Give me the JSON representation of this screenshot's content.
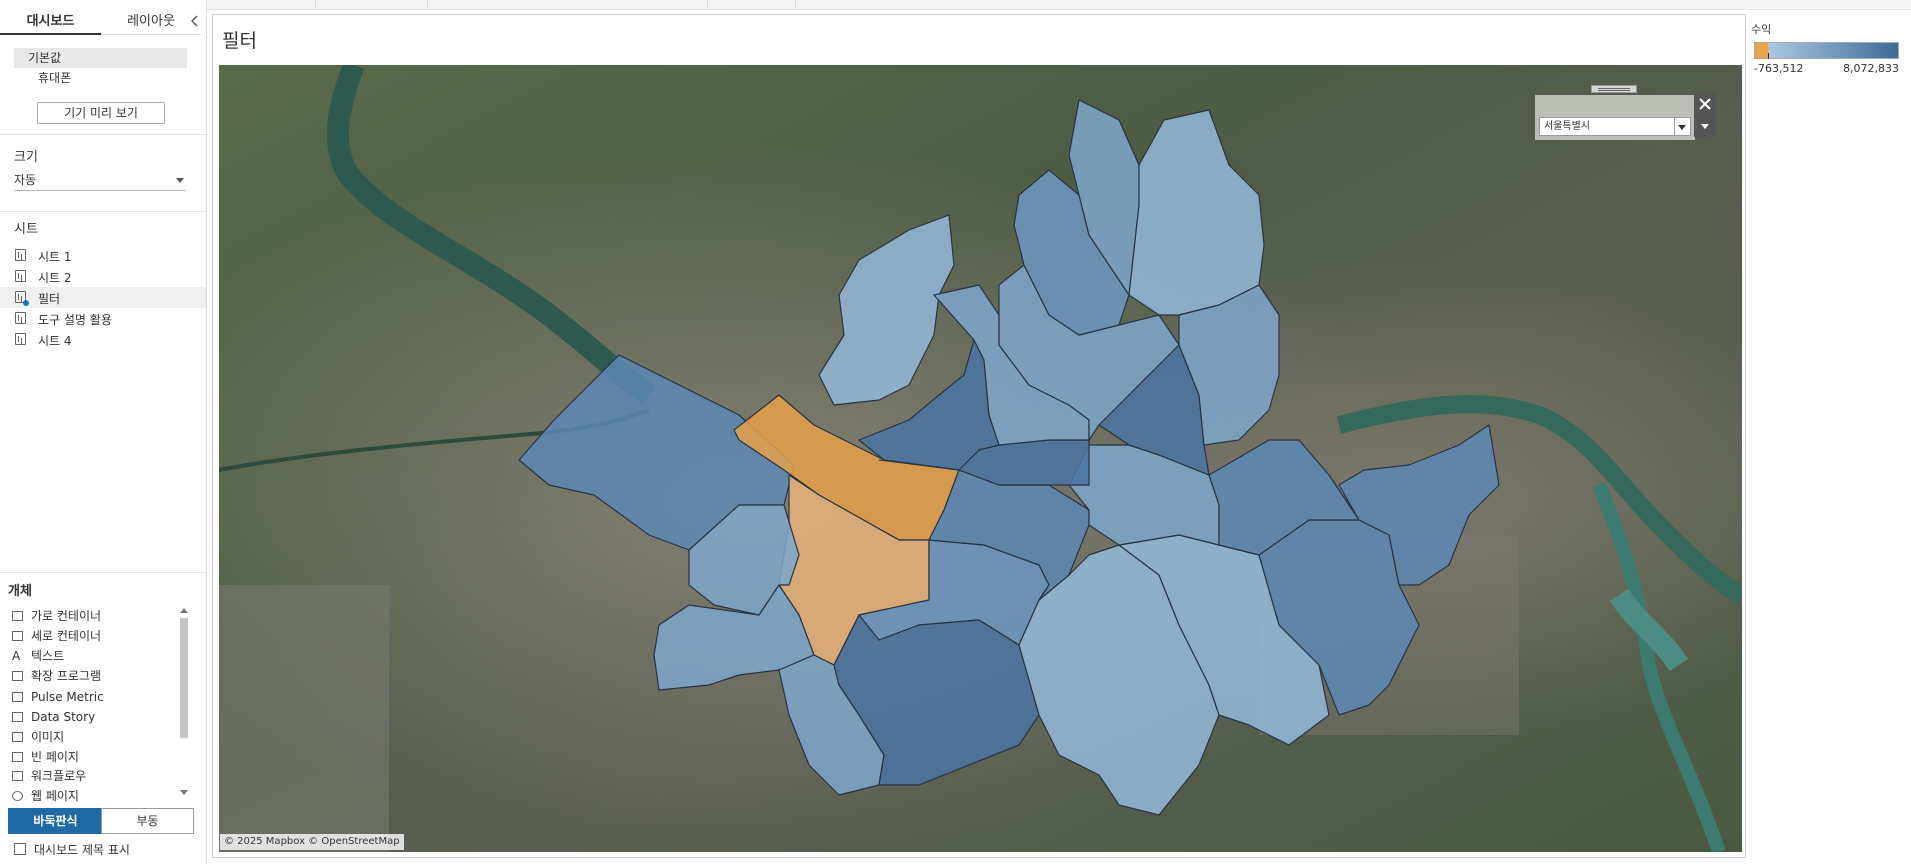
{
  "left_panel": {
    "tabs": {
      "dashboard": "대시보드",
      "layout": "레이아웃"
    },
    "devices": {
      "default": "기본값",
      "phone": "휴대폰"
    },
    "preview_button": "기기 미리 보기",
    "size": {
      "title": "크기",
      "value": "자동"
    },
    "sheets": {
      "title": "시트",
      "items": [
        {
          "label": "시트 1",
          "active": false
        },
        {
          "label": "시트 2",
          "active": false
        },
        {
          "label": "필터",
          "active": true
        },
        {
          "label": "도구 설명 활용",
          "active": false
        },
        {
          "label": "시트 4",
          "active": false
        }
      ]
    },
    "objects": {
      "title": "개체",
      "items": [
        {
          "label": "가로 컨테이너",
          "icon": "horizontal-container-icon"
        },
        {
          "label": "세로 컨테이너",
          "icon": "vertical-container-icon"
        },
        {
          "label": "텍스트",
          "icon": "text-icon"
        },
        {
          "label": "확장 프로그램",
          "icon": "extension-icon"
        },
        {
          "label": "Pulse Metric",
          "icon": "pulse-metric-icon"
        },
        {
          "label": "Data Story",
          "icon": "data-story-icon"
        },
        {
          "label": "이미지",
          "icon": "image-icon"
        },
        {
          "label": "빈 페이지",
          "icon": "blank-icon"
        },
        {
          "label": "워크플로우",
          "icon": "workflow-icon"
        },
        {
          "label": "웹 페이지",
          "icon": "web-page-icon"
        }
      ]
    },
    "layout_mode": {
      "tiled": "바둑판식",
      "floating": "부동"
    },
    "show_title": "대시보드 제목 표시"
  },
  "dashboard": {
    "title": "필터",
    "attribution": "© 2025 Mapbox © OpenStreetMap",
    "filter": {
      "selected": "서울특별시"
    },
    "legend": {
      "title": "수익",
      "min": "-763,512",
      "max": "8,072,833",
      "color_negative": "#e9a54a",
      "color_low": "#a9c8e3",
      "color_high": "#3e6a97"
    },
    "map": {
      "type": "choropleth",
      "basemap": "satellite",
      "region": "서울특별시",
      "colors": {
        "negative_strong": "#e5a049",
        "negative_light": "#e6b278",
        "blue_1": "#94b9d9",
        "blue_2": "#7ea7cc",
        "blue_3": "#6d98c3",
        "blue_4": "#5c88b5",
        "blue_5": "#4a74a3"
      }
    }
  }
}
